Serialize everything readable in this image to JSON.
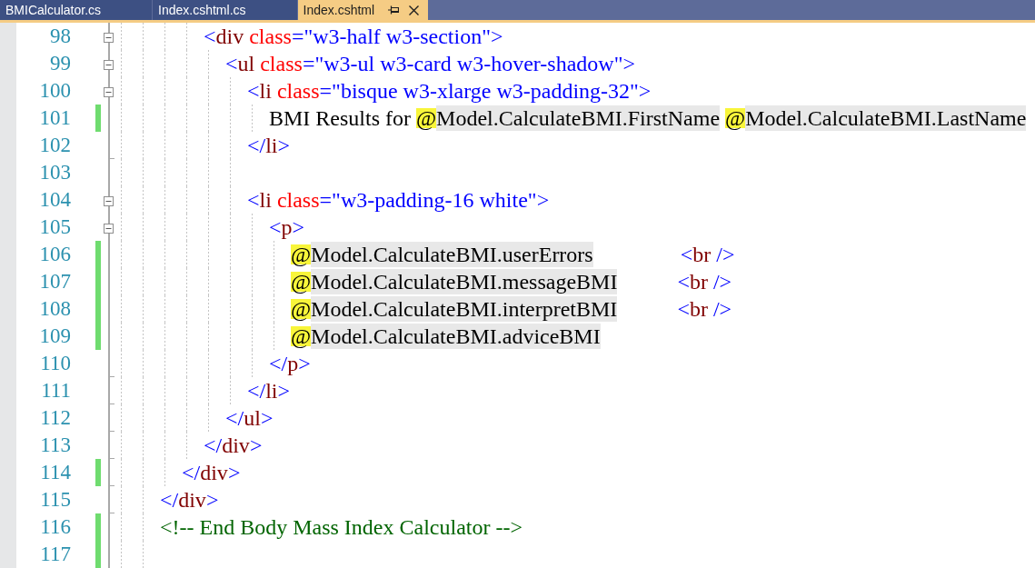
{
  "tabs": [
    {
      "label": "BMICalculator.cs",
      "selected": false
    },
    {
      "label": "Index.cshtml.cs",
      "selected": false
    },
    {
      "label": "Index.cshtml",
      "selected": true
    }
  ],
  "editor": {
    "lines": [
      {
        "number": "98",
        "changed": false,
        "expanded": true,
        "fold_end": false,
        "tokens": [
          {
            "kind": "delim",
            "text": "                <"
          },
          {
            "kind": "element",
            "text": "div"
          },
          {
            "kind": "attribute",
            "text": " class"
          },
          {
            "kind": "delim",
            "text": "="
          },
          {
            "kind": "value",
            "text": "\"w3-half w3-section\""
          },
          {
            "kind": "delim",
            "text": ">"
          }
        ]
      },
      {
        "number": "99",
        "changed": false,
        "expanded": true,
        "fold_end": false,
        "tokens": [
          {
            "kind": "delim",
            "text": "                    <"
          },
          {
            "kind": "element",
            "text": "ul"
          },
          {
            "kind": "attribute",
            "text": " class"
          },
          {
            "kind": "delim",
            "text": "="
          },
          {
            "kind": "value",
            "text": "\"w3-ul w3-card w3-hover-shadow\""
          },
          {
            "kind": "delim",
            "text": ">"
          }
        ]
      },
      {
        "number": "100",
        "changed": false,
        "expanded": true,
        "fold_end": false,
        "tokens": [
          {
            "kind": "delim",
            "text": "                        <"
          },
          {
            "kind": "element",
            "text": "li"
          },
          {
            "kind": "attribute",
            "text": " class"
          },
          {
            "kind": "delim",
            "text": "="
          },
          {
            "kind": "value",
            "text": "\"bisque w3-xlarge w3-padding-32\""
          },
          {
            "kind": "delim",
            "text": ">"
          }
        ]
      },
      {
        "number": "101",
        "changed": true,
        "fold_end": false,
        "tokens": [
          {
            "kind": "text",
            "text": "                            BMI Results for "
          },
          {
            "kind": "razor",
            "text": "@"
          },
          {
            "kind": "code",
            "text": "Model.CalculateBMI.FirstName"
          },
          {
            "kind": "razor",
            "text": " @"
          },
          {
            "kind": "code",
            "text": "Model.CalculateBMI.LastName"
          }
        ]
      },
      {
        "number": "102",
        "changed": false,
        "fold_end": true,
        "tokens": [
          {
            "kind": "delim",
            "text": "                        </"
          },
          {
            "kind": "element",
            "text": "li"
          },
          {
            "kind": "delim",
            "text": ">"
          }
        ]
      },
      {
        "number": "103",
        "changed": false,
        "fold_end": false
      },
      {
        "number": "104",
        "changed": false,
        "expanded": true,
        "fold_end": false,
        "tokens": [
          {
            "kind": "delim",
            "text": "                        <"
          },
          {
            "kind": "element",
            "text": "li"
          },
          {
            "kind": "attribute",
            "text": " class"
          },
          {
            "kind": "delim",
            "text": "="
          },
          {
            "kind": "value",
            "text": "\"w3-padding-16 white\""
          },
          {
            "kind": "delim",
            "text": ">"
          }
        ]
      },
      {
        "number": "105",
        "changed": false,
        "expanded": true,
        "fold_end": false,
        "tokens": [
          {
            "kind": "delim",
            "text": "                            <"
          },
          {
            "kind": "element",
            "text": "p"
          },
          {
            "kind": "delim",
            "text": ">"
          }
        ]
      },
      {
        "number": "106",
        "changed": true,
        "fold_end": false,
        "tokens": [
          {
            "kind": "razor",
            "text": "                                @"
          },
          {
            "kind": "code",
            "text": "Model.CalculateBMI.userErrors"
          },
          {
            "kind": "delim",
            "text": "                <"
          },
          {
            "kind": "element",
            "text": "br"
          },
          {
            "kind": "delim",
            "text": " />"
          }
        ]
      },
      {
        "number": "107",
        "changed": true,
        "fold_end": false,
        "tokens": [
          {
            "kind": "razor",
            "text": "                                @"
          },
          {
            "kind": "code",
            "text": "Model.CalculateBMI.messageBMI"
          },
          {
            "kind": "delim",
            "text": "           <"
          },
          {
            "kind": "element",
            "text": "br"
          },
          {
            "kind": "delim",
            "text": " />"
          }
        ]
      },
      {
        "number": "108",
        "changed": true,
        "fold_end": false,
        "tokens": [
          {
            "kind": "razor",
            "text": "                                @"
          },
          {
            "kind": "code",
            "text": "Model.CalculateBMI.interpretBMI"
          },
          {
            "kind": "delim",
            "text": "           <"
          },
          {
            "kind": "element",
            "text": "br"
          },
          {
            "kind": "delim",
            "text": " />"
          }
        ]
      },
      {
        "number": "109",
        "changed": true,
        "fold_end": false,
        "tokens": [
          {
            "kind": "razor",
            "text": "                                @"
          },
          {
            "kind": "code",
            "text": "Model.CalculateBMI.adviceBMI"
          }
        ]
      },
      {
        "number": "110",
        "changed": false,
        "fold_end": true,
        "tokens": [
          {
            "kind": "delim",
            "text": "                            </"
          },
          {
            "kind": "element",
            "text": "p"
          },
          {
            "kind": "delim",
            "text": ">"
          }
        ]
      },
      {
        "number": "111",
        "changed": false,
        "fold_end": true,
        "tokens": [
          {
            "kind": "delim",
            "text": "                        </"
          },
          {
            "kind": "element",
            "text": "li"
          },
          {
            "kind": "delim",
            "text": ">"
          }
        ]
      },
      {
        "number": "112",
        "changed": false,
        "fold_end": true,
        "tokens": [
          {
            "kind": "delim",
            "text": "                    </"
          },
          {
            "kind": "element",
            "text": "ul"
          },
          {
            "kind": "delim",
            "text": ">"
          }
        ]
      },
      {
        "number": "113",
        "changed": false,
        "fold_end": true,
        "tokens": [
          {
            "kind": "delim",
            "text": "                </"
          },
          {
            "kind": "element",
            "text": "div"
          },
          {
            "kind": "delim",
            "text": ">"
          }
        ]
      },
      {
        "number": "114",
        "changed": true,
        "fold_end": true,
        "tokens": [
          {
            "kind": "delim",
            "text": "            </"
          },
          {
            "kind": "element",
            "text": "div"
          },
          {
            "kind": "delim",
            "text": ">"
          }
        ]
      },
      {
        "number": "115",
        "changed": false,
        "fold_end": true,
        "tokens": [
          {
            "kind": "delim",
            "text": "        </"
          },
          {
            "kind": "element",
            "text": "div"
          },
          {
            "kind": "delim",
            "text": ">"
          }
        ]
      },
      {
        "number": "116",
        "changed": true,
        "fold_end": false,
        "tokens": [
          {
            "kind": "comment",
            "text": "        <!-- End Body Mass Index Calculator -->"
          }
        ]
      },
      {
        "number": "117",
        "changed": true,
        "fold_end": false
      }
    ]
  }
}
